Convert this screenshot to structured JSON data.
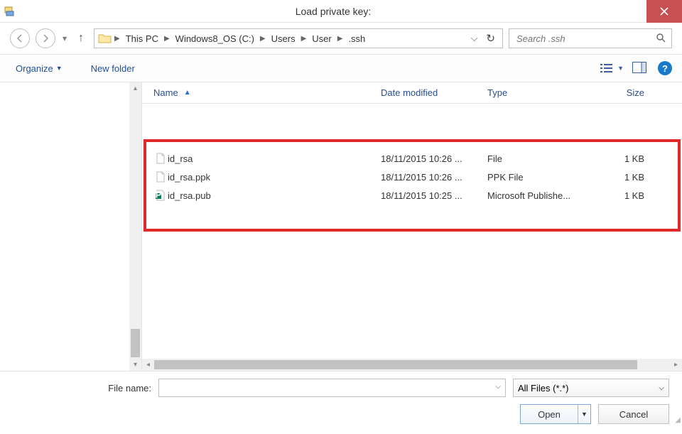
{
  "window": {
    "title": "Load private key:"
  },
  "breadcrumb": {
    "segments": [
      "This PC",
      "Windows8_OS (C:)",
      "Users",
      "User",
      ".ssh"
    ]
  },
  "search": {
    "placeholder": "Search .ssh"
  },
  "toolbar": {
    "organize": "Organize",
    "new_folder": "New folder"
  },
  "columns": {
    "name": "Name",
    "date": "Date modified",
    "type": "Type",
    "size": "Size"
  },
  "files": [
    {
      "name": "id_rsa",
      "date": "18/11/2015 10:26 ...",
      "type": "File",
      "size": "1 KB",
      "icon": "file"
    },
    {
      "name": "id_rsa.ppk",
      "date": "18/11/2015 10:26 ...",
      "type": "PPK File",
      "size": "1 KB",
      "icon": "file"
    },
    {
      "name": "id_rsa.pub",
      "date": "18/11/2015 10:25 ...",
      "type": "Microsoft Publishe...",
      "size": "1 KB",
      "icon": "pub"
    }
  ],
  "bottom": {
    "filename_label": "File name:",
    "filename_value": "",
    "filter": "All Files (*.*)",
    "open": "Open",
    "cancel": "Cancel"
  }
}
